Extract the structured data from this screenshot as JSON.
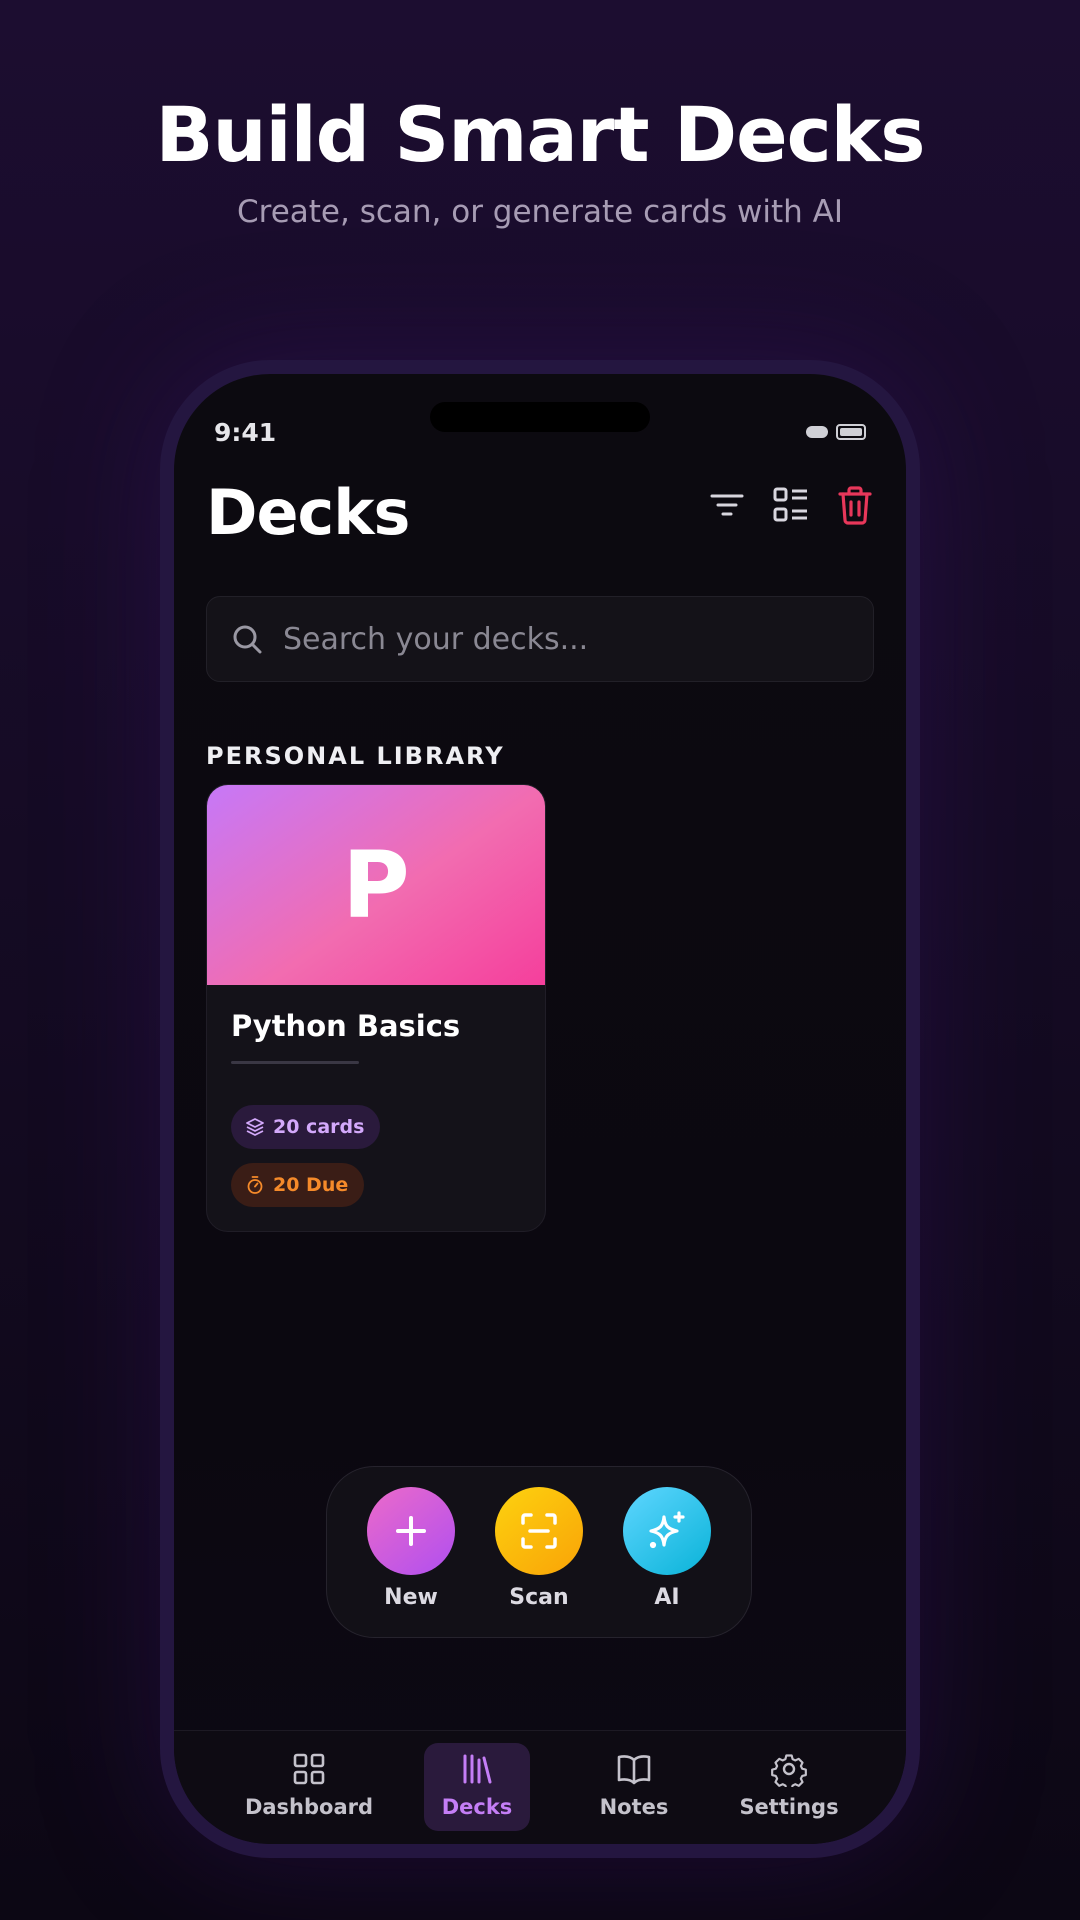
{
  "hero": {
    "title": "Build Smart Decks",
    "subtitle": "Create, scan, or generate cards with AI"
  },
  "status_bar": {
    "time": "9:41"
  },
  "header": {
    "title": "Decks",
    "actions": [
      "filter-icon",
      "list-view-icon",
      "trash-icon"
    ]
  },
  "search": {
    "placeholder": "Search your decks...",
    "value": ""
  },
  "section": {
    "label": "PERSONAL LIBRARY"
  },
  "decks": [
    {
      "initial": "P",
      "name": "Python Basics",
      "cards_label": "20 cards",
      "due_label": "20 Due"
    }
  ],
  "actions": {
    "new_label": "New",
    "scan_label": "Scan",
    "ai_label": "AI"
  },
  "nav": {
    "items": [
      {
        "label": "Dashboard",
        "icon": "grid-icon"
      },
      {
        "label": "Decks",
        "icon": "library-icon",
        "active": true
      },
      {
        "label": "Notes",
        "icon": "book-open-icon"
      },
      {
        "label": "Settings",
        "icon": "gear-icon"
      }
    ]
  },
  "colors": {
    "accent": "#c47ef6",
    "danger": "#e8375a",
    "due": "#f58a2a"
  }
}
